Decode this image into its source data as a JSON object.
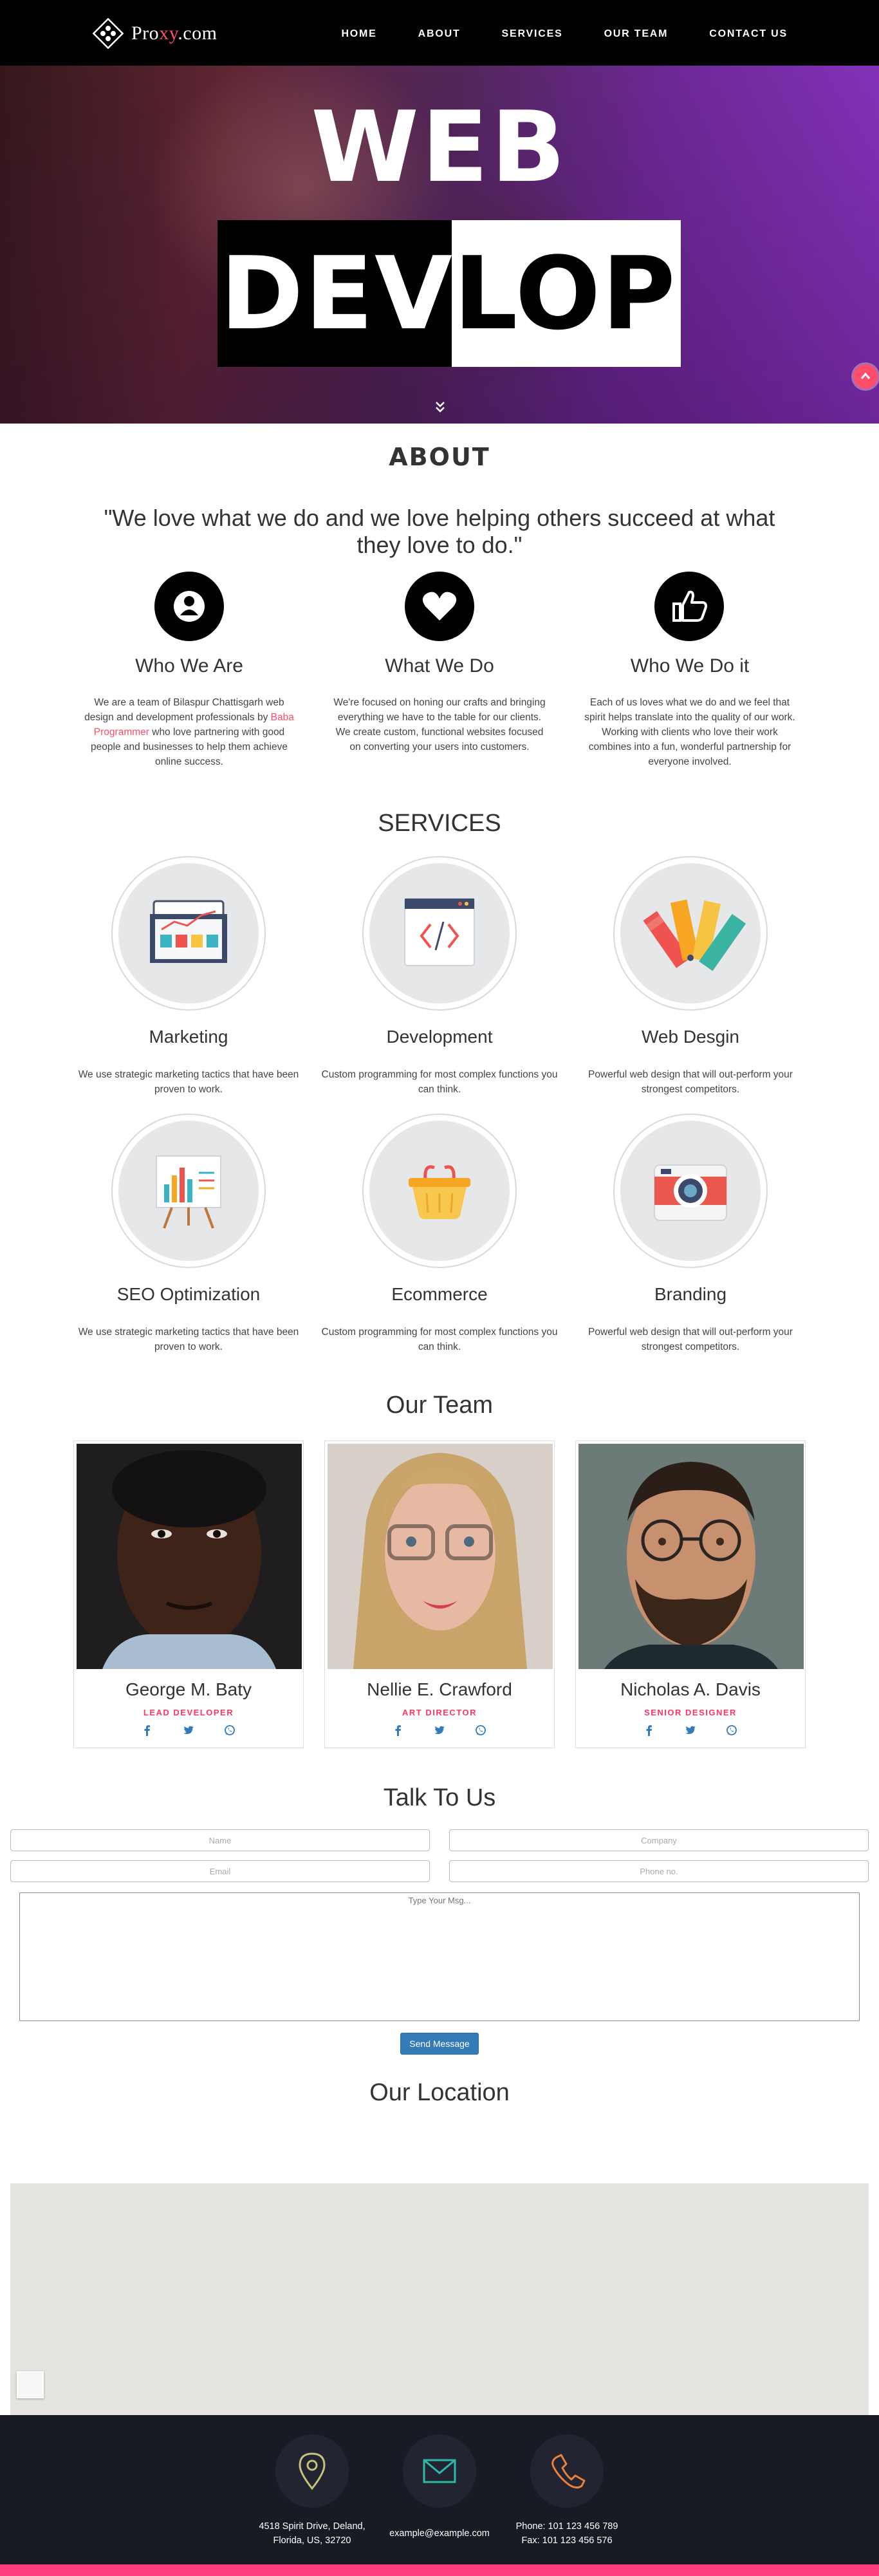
{
  "nav": {
    "logo": {
      "pre": "Pro",
      "accent": "xy",
      "post": ".com"
    },
    "items": [
      {
        "label": "HOME"
      },
      {
        "label": "ABOUT"
      },
      {
        "label": "SERVICES"
      },
      {
        "label": "OUR TEAM"
      },
      {
        "label": "CONTACT US"
      }
    ]
  },
  "hero": {
    "line1": "WEB",
    "line2_white": "DEV",
    "line2_black": "LOP"
  },
  "about": {
    "title": "ABOUT",
    "quote": "\"We love what we do and we love helping others succeed at what they love to do.\"",
    "features": [
      {
        "icon": "user-icon",
        "title": "Who We Are",
        "text_before": "We are a team of Bilaspur Chattisgarh web design and development professionals by ",
        "link": "Baba Programmer",
        "text_after": " who love partnering with good people and businesses to help them achieve online success."
      },
      {
        "icon": "heart-icon",
        "title": "What We Do",
        "text": "We're focused on honing our crafts and bringing everything we have to the table for our clients. We create custom, functional websites focused on converting your users into customers."
      },
      {
        "icon": "thumbs-up-icon",
        "title": "Who We Do it",
        "text": "Each of us loves what we do and we feel that spirit helps translate into the quality of our work. Working with clients who love their work combines into a fun, wonderful partnership for everyone involved."
      }
    ]
  },
  "services": {
    "title": "SERVICES",
    "items": [
      {
        "icon": "marketing-icon",
        "title": "Marketing",
        "text": "We use strategic marketing tactics that have been proven to work."
      },
      {
        "icon": "code-window-icon",
        "title": "Development",
        "text": "Custom programming for most complex functions you can think."
      },
      {
        "icon": "color-palette-icon",
        "title": "Web Desgin",
        "text": "Powerful web design that will out-perform your strongest competitors."
      },
      {
        "icon": "presentation-chart-icon",
        "title": "SEO Optimization",
        "text": "We use strategic marketing tactics that have been proven to work."
      },
      {
        "icon": "shopping-basket-icon",
        "title": "Ecommerce",
        "text": "Custom programming for most complex functions you can think."
      },
      {
        "icon": "camera-icon",
        "title": "Branding",
        "text": "Powerful web design that will out-perform your strongest competitors."
      }
    ]
  },
  "team": {
    "title": "Our Team",
    "members": [
      {
        "name": "George M. Baty",
        "role": "LEAD DEVELOPER"
      },
      {
        "name": "Nellie E. Crawford",
        "role": "ART DIRECTOR"
      },
      {
        "name": "Nicholas A. Davis",
        "role": "SENIOR DESIGNER"
      }
    ],
    "socials": [
      "facebook-icon",
      "twitter-icon",
      "whatsapp-icon"
    ]
  },
  "contact": {
    "title": "Talk To Us",
    "name_placeholder": "Name",
    "company_placeholder": "Company",
    "email_placeholder": "Email",
    "phone_placeholder": "Phone no.",
    "message_placeholder": "Type Your Msg...",
    "send_label": "Send Message"
  },
  "location": {
    "title": "Our Location"
  },
  "footer": {
    "address_line1": "4518 Spirit Drive, Deland,",
    "address_line2": "Florida, US, 32720",
    "email": "example@example.com",
    "phone": "Phone: 101 123 456 789",
    "fax": "Fax: 101 123 456 576"
  },
  "colors": {
    "accent": "#ff4d6a",
    "role": "#ff3366",
    "button": "#337ab7",
    "footer_bg": "#191b24",
    "footer_bar": "#ff3d7f"
  }
}
